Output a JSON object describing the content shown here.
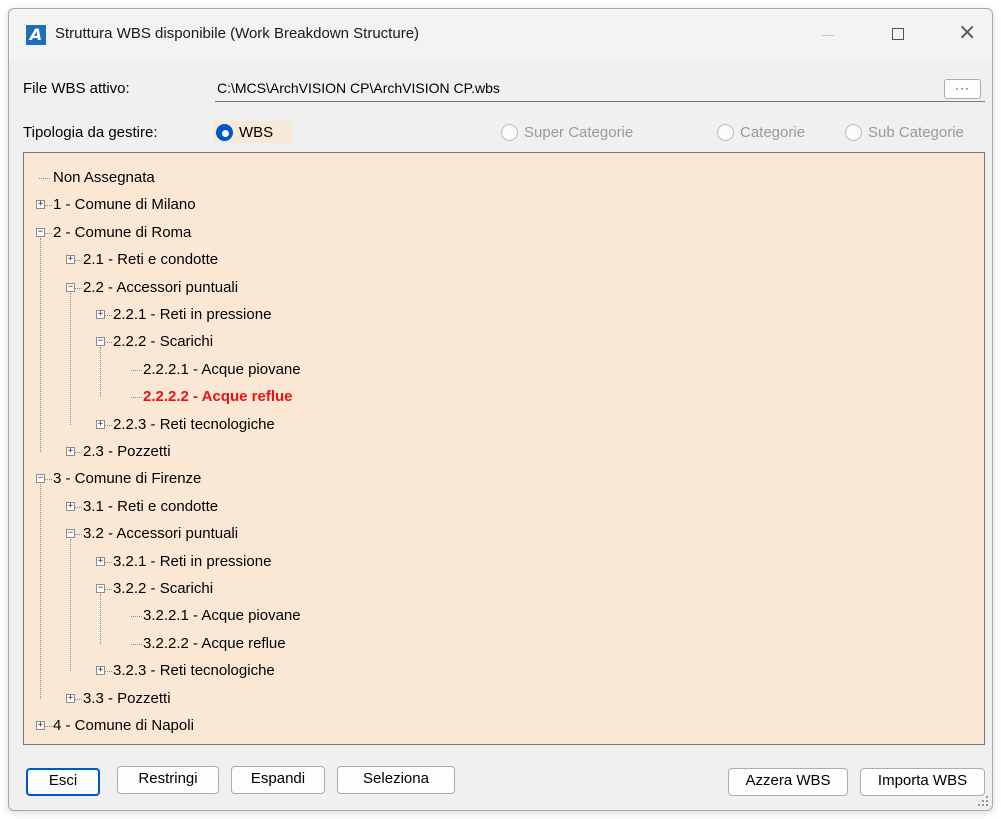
{
  "window": {
    "title": "Struttura WBS disponibile (Work Breakdown Structure)",
    "app_icon_letter": "A"
  },
  "form": {
    "file_label": "File WBS attivo:",
    "file_value": "C:\\MCS\\ArchVISION CP\\ArchVISION CP.wbs",
    "browse_label": "···",
    "type_label": "Tipologia da gestire:",
    "type_options": [
      {
        "label": "WBS",
        "selected": true,
        "enabled": true
      },
      {
        "label": "Super Categorie",
        "selected": false,
        "enabled": false
      },
      {
        "label": "Categorie",
        "selected": false,
        "enabled": false
      },
      {
        "label": "Sub Categorie",
        "selected": false,
        "enabled": false
      }
    ]
  },
  "tree": {
    "nodes": [
      {
        "label": "Non Assegnata",
        "level": 0,
        "expander": "none"
      },
      {
        "label": "1 - Comune di Milano",
        "level": 0,
        "expander": "plus"
      },
      {
        "label": "2 - Comune di Roma",
        "level": 0,
        "expander": "minus"
      },
      {
        "label": "2.1 - Reti e condotte",
        "level": 1,
        "expander": "plus"
      },
      {
        "label": "2.2 - Accessori puntuali",
        "level": 1,
        "expander": "minus"
      },
      {
        "label": "2.2.1 - Reti in pressione",
        "level": 2,
        "expander": "plus"
      },
      {
        "label": "2.2.2 - Scarichi",
        "level": 2,
        "expander": "minus"
      },
      {
        "label": "2.2.2.1 - Acque piovane",
        "level": 3,
        "expander": "none"
      },
      {
        "label": "2.2.2.2 - Acque reflue",
        "level": 3,
        "expander": "none",
        "selected": true
      },
      {
        "label": "2.2.3 - Reti tecnologiche",
        "level": 2,
        "expander": "plus"
      },
      {
        "label": "2.3 - Pozzetti",
        "level": 1,
        "expander": "plus"
      },
      {
        "label": "3 - Comune di Firenze",
        "level": 0,
        "expander": "minus"
      },
      {
        "label": "3.1 - Reti e condotte",
        "level": 1,
        "expander": "plus"
      },
      {
        "label": "3.2 - Accessori puntuali",
        "level": 1,
        "expander": "minus"
      },
      {
        "label": "3.2.1 - Reti in pressione",
        "level": 2,
        "expander": "plus"
      },
      {
        "label": "3.2.2 - Scarichi",
        "level": 2,
        "expander": "minus"
      },
      {
        "label": "3.2.2.1 - Acque piovane",
        "level": 3,
        "expander": "none"
      },
      {
        "label": "3.2.2.2 - Acque reflue",
        "level": 3,
        "expander": "none"
      },
      {
        "label": "3.2.3 - Reti tecnologiche",
        "level": 2,
        "expander": "plus"
      },
      {
        "label": "3.3 - Pozzetti",
        "level": 1,
        "expander": "plus"
      },
      {
        "label": "4 - Comune di Napoli",
        "level": 0,
        "expander": "plus"
      }
    ]
  },
  "buttons": {
    "esci": "Esci",
    "restringi": "Restringi",
    "espandi": "Espandi",
    "seleziona": "Seleziona",
    "azzera": "Azzera WBS",
    "importa": "Importa WBS"
  },
  "colors": {
    "tree_background": "#fbe8d4",
    "selected_node_text": "#ee1111",
    "accent": "#0057c8"
  }
}
